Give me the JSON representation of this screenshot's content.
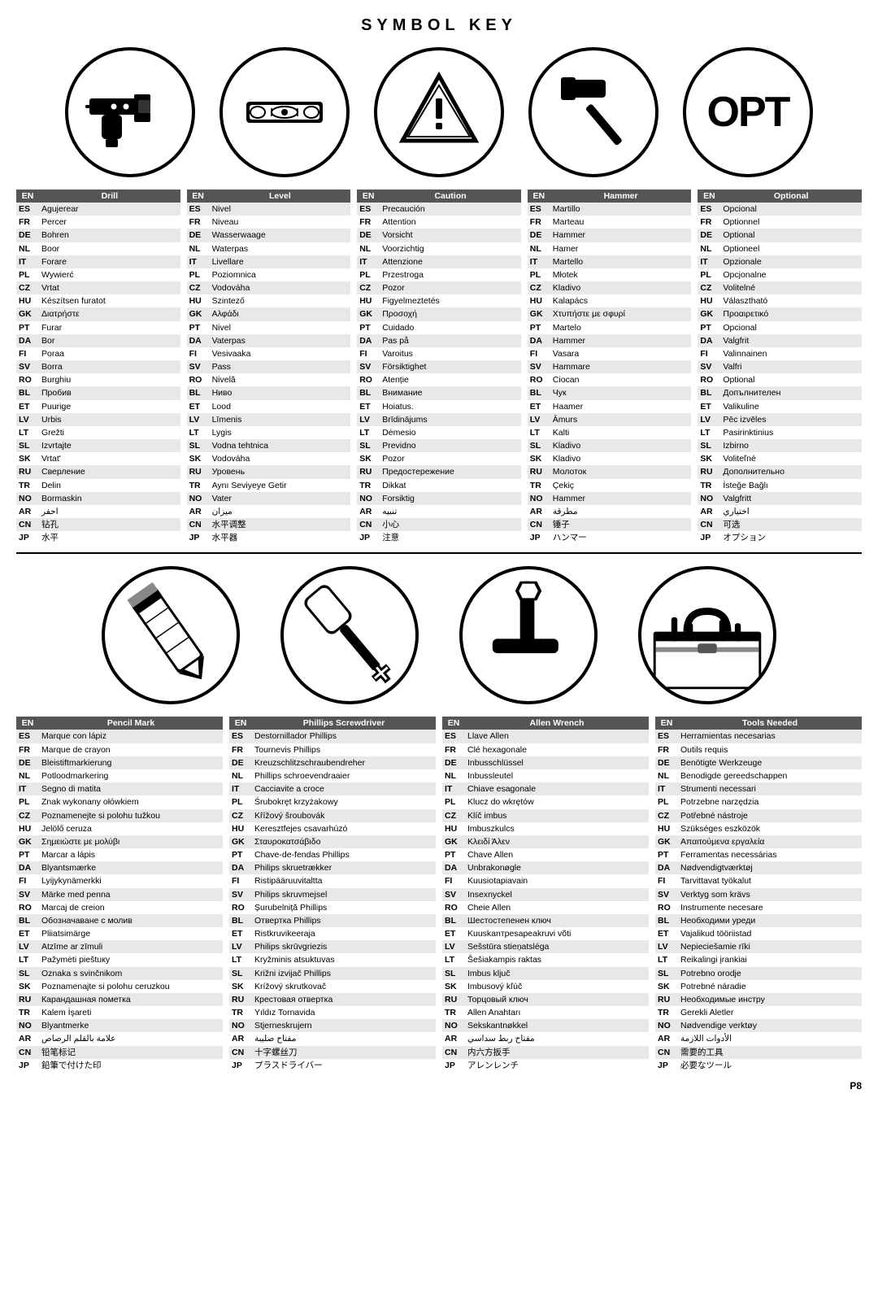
{
  "title": "SYMBOL KEY",
  "page_number": "P8",
  "icons_row1": [
    {
      "name": "drill",
      "type": "drill"
    },
    {
      "name": "level",
      "type": "level"
    },
    {
      "name": "caution",
      "type": "caution"
    },
    {
      "name": "hammer",
      "type": "hammer"
    },
    {
      "name": "optional",
      "type": "opt-text",
      "text": "OPT"
    }
  ],
  "icons_row2": [
    {
      "name": "pencil",
      "type": "pencil"
    },
    {
      "name": "phillips",
      "type": "phillips"
    },
    {
      "name": "allen",
      "type": "allen"
    },
    {
      "name": "toolbox",
      "type": "toolbox"
    }
  ],
  "tables": [
    {
      "id": "drill",
      "header1": "EN",
      "header2": "Drill",
      "rows": [
        [
          "ES",
          "Agujerear"
        ],
        [
          "FR",
          "Percer"
        ],
        [
          "DE",
          "Bohren"
        ],
        [
          "NL",
          "Boor"
        ],
        [
          "IT",
          "Forare"
        ],
        [
          "PL",
          "Wywierć"
        ],
        [
          "CZ",
          "Vrtat"
        ],
        [
          "HU",
          "Készítsen furatot"
        ],
        [
          "GK",
          "Διατρήστε"
        ],
        [
          "PT",
          "Furar"
        ],
        [
          "DA",
          "Bor"
        ],
        [
          "FI",
          "Poraa"
        ],
        [
          "SV",
          "Borra"
        ],
        [
          "RO",
          "Burghiu"
        ],
        [
          "BL",
          "Пробив"
        ],
        [
          "ET",
          "Puurige"
        ],
        [
          "LV",
          "Urbis"
        ],
        [
          "LT",
          "Grežti"
        ],
        [
          "SL",
          "Izvrtajte"
        ],
        [
          "SK",
          "Vrtat'"
        ],
        [
          "RU",
          "Сверление"
        ],
        [
          "TR",
          "Delin"
        ],
        [
          "NO",
          "Bormaskin"
        ],
        [
          "AR",
          "احفر"
        ],
        [
          "CN",
          "钻孔"
        ],
        [
          "JP",
          "水平"
        ]
      ]
    },
    {
      "id": "level",
      "header1": "EN",
      "header2": "Level",
      "rows": [
        [
          "ES",
          "Nivel"
        ],
        [
          "FR",
          "Niveau"
        ],
        [
          "DE",
          "Wasserwaage"
        ],
        [
          "NL",
          "Waterpas"
        ],
        [
          "IT",
          "Livellare"
        ],
        [
          "PL",
          "Poziomnica"
        ],
        [
          "CZ",
          "Vodováha"
        ],
        [
          "HU",
          "Szintező"
        ],
        [
          "GK",
          "Αλφάδι"
        ],
        [
          "PT",
          "Nivel"
        ],
        [
          "DA",
          "Vaterpas"
        ],
        [
          "FI",
          "Vesivaaka"
        ],
        [
          "SV",
          "Pass"
        ],
        [
          "RO",
          "Nivelă"
        ],
        [
          "BL",
          "Ниво"
        ],
        [
          "ET",
          "Lood"
        ],
        [
          "LV",
          "Līmenis"
        ],
        [
          "LT",
          "Lygis"
        ],
        [
          "SL",
          "Vodna tehtnica"
        ],
        [
          "SK",
          "Vodováha"
        ],
        [
          "RU",
          "Уровень"
        ],
        [
          "TR",
          "Aynı Seviyeye Getir"
        ],
        [
          "NO",
          "Vater"
        ],
        [
          "AR",
          "ميزان"
        ],
        [
          "CN",
          "水平调整"
        ],
        [
          "JP",
          "水平器"
        ]
      ]
    },
    {
      "id": "caution",
      "header1": "EN",
      "header2": "Caution",
      "rows": [
        [
          "ES",
          "Precaución"
        ],
        [
          "FR",
          "Attention"
        ],
        [
          "DE",
          "Vorsicht"
        ],
        [
          "NL",
          "Voorzichtig"
        ],
        [
          "IT",
          "Attenzione"
        ],
        [
          "PL",
          "Przestroga"
        ],
        [
          "CZ",
          "Pozor"
        ],
        [
          "HU",
          "Figyelmeztetés"
        ],
        [
          "GK",
          "Προσοχή"
        ],
        [
          "PT",
          "Cuidado"
        ],
        [
          "DA",
          "Pas på"
        ],
        [
          "FI",
          "Varoitus"
        ],
        [
          "SV",
          "Försiktighet"
        ],
        [
          "RO",
          "Atenție"
        ],
        [
          "BL",
          "Внимание"
        ],
        [
          "ET",
          "Hoiatus."
        ],
        [
          "LV",
          "Brīdinājums"
        ],
        [
          "LT",
          "Dėmesio"
        ],
        [
          "SL",
          "Previdno"
        ],
        [
          "SK",
          "Pozor"
        ],
        [
          "RU",
          "Предостережение"
        ],
        [
          "TR",
          "Dikkat"
        ],
        [
          "NO",
          "Forsiktig"
        ],
        [
          "AR",
          "تنبيه"
        ],
        [
          "CN",
          "小心"
        ],
        [
          "JP",
          "注意"
        ]
      ]
    },
    {
      "id": "hammer",
      "header1": "EN",
      "header2": "Hammer",
      "rows": [
        [
          "ES",
          "Martillo"
        ],
        [
          "FR",
          "Marteau"
        ],
        [
          "DE",
          "Hammer"
        ],
        [
          "NL",
          "Hamer"
        ],
        [
          "IT",
          "Martello"
        ],
        [
          "PL",
          "Młotek"
        ],
        [
          "CZ",
          "Kladivo"
        ],
        [
          "HU",
          "Kalapács"
        ],
        [
          "GK",
          "Χτυπήστε με σφυρί"
        ],
        [
          "PT",
          "Martelo"
        ],
        [
          "DA",
          "Hammer"
        ],
        [
          "FI",
          "Vasara"
        ],
        [
          "SV",
          "Hammare"
        ],
        [
          "RO",
          "Ciocan"
        ],
        [
          "BL",
          "Чук"
        ],
        [
          "ET",
          "Haamer"
        ],
        [
          "LV",
          "Āmurs"
        ],
        [
          "LT",
          "Kalti"
        ],
        [
          "SL",
          "Kladivo"
        ],
        [
          "SK",
          "Kladivo"
        ],
        [
          "RU",
          "Молоток"
        ],
        [
          "TR",
          "Çekiç"
        ],
        [
          "NO",
          "Hammer"
        ],
        [
          "AR",
          "مطرقة"
        ],
        [
          "CN",
          "锤子"
        ],
        [
          "JP",
          "ハンマー"
        ]
      ]
    },
    {
      "id": "optional",
      "header1": "EN",
      "header2": "Optional",
      "rows": [
        [
          "ES",
          "Opcional"
        ],
        [
          "FR",
          "Optionnel"
        ],
        [
          "DE",
          "Optional"
        ],
        [
          "NL",
          "Optioneel"
        ],
        [
          "IT",
          "Opzionale"
        ],
        [
          "PL",
          "Opcjonalne"
        ],
        [
          "CZ",
          "Volitelné"
        ],
        [
          "HU",
          "Választható"
        ],
        [
          "GK",
          "Προαιρετικό"
        ],
        [
          "PT",
          "Opcional"
        ],
        [
          "DA",
          "Valgfrit"
        ],
        [
          "FI",
          "Valinnainen"
        ],
        [
          "SV",
          "Valfri"
        ],
        [
          "RO",
          "Optional"
        ],
        [
          "BL",
          "Допълнителен"
        ],
        [
          "ET",
          "Valikuline"
        ],
        [
          "LV",
          "Pēc izvēles"
        ],
        [
          "LT",
          "Pasirinktinius"
        ],
        [
          "SL",
          "Izbirno"
        ],
        [
          "SK",
          "Voliteľné"
        ],
        [
          "RU",
          "Дополнительно"
        ],
        [
          "TR",
          "İsteğe Bağlı"
        ],
        [
          "NO",
          "Valgfritt"
        ],
        [
          "AR",
          "اختياري"
        ],
        [
          "CN",
          "可选"
        ],
        [
          "JP",
          "オプション"
        ]
      ]
    }
  ],
  "tables2": [
    {
      "id": "pencil",
      "header1": "EN",
      "header2": "Pencil Mark",
      "rows": [
        [
          "ES",
          "Marque con lápiz"
        ],
        [
          "FR",
          "Marque de crayon"
        ],
        [
          "DE",
          "Bleistiftmarkierung"
        ],
        [
          "NL",
          "Potloodmarkering"
        ],
        [
          "IT",
          "Segno di matita"
        ],
        [
          "PL",
          "Znak wykonany ołówkiem"
        ],
        [
          "CZ",
          "Poznamenejte si polohu tužkou"
        ],
        [
          "HU",
          "Jelölő ceruza"
        ],
        [
          "GK",
          "Σημειώστε με μολύβι"
        ],
        [
          "PT",
          "Marcar a lápis"
        ],
        [
          "DA",
          "Blyantsmærke"
        ],
        [
          "FI",
          "Lyijykynämerkki"
        ],
        [
          "SV",
          "Märke med penna"
        ],
        [
          "RO",
          "Marcaj de creion"
        ],
        [
          "BL",
          "Обозначаване с молив"
        ],
        [
          "ET",
          "Pliiatsimärge"
        ],
        [
          "LV",
          "Atzīme ar zīmuli"
        ],
        [
          "LT",
          "Pažymėti pieštuку"
        ],
        [
          "SL",
          "Oznaka s svinčnikom"
        ],
        [
          "SK",
          "Poznamenajte si polohu ceruzkou"
        ],
        [
          "RU",
          "Карандашная пометка"
        ],
        [
          "TR",
          "Kalem İşareti"
        ],
        [
          "NO",
          "Blyantmerke"
        ],
        [
          "AR",
          "علامة بالقلم الرصاص"
        ],
        [
          "CN",
          "铅笔标记"
        ],
        [
          "JP",
          "鉛筆で付けた印"
        ]
      ]
    },
    {
      "id": "phillips",
      "header1": "EN",
      "header2": "Phillips Screwdriver",
      "rows": [
        [
          "ES",
          "Destornillador Phillips"
        ],
        [
          "FR",
          "Tournevis Phillips"
        ],
        [
          "DE",
          "Kreuzschlitzschraubendreher"
        ],
        [
          "NL",
          "Phillips schroevendraaier"
        ],
        [
          "IT",
          "Cacciavite a croce"
        ],
        [
          "PL",
          "Śrubokręt krzyżakowy"
        ],
        [
          "CZ",
          "Křížový šroubovák"
        ],
        [
          "HU",
          "Keresztfejes csavarhúzó"
        ],
        [
          "GK",
          "Σταυροκατσάβιδο"
        ],
        [
          "PT",
          "Chave-de-fendas Phillips"
        ],
        [
          "DA",
          "Philips skruetrækker"
        ],
        [
          "FI",
          "Ristipääruuvitaltta"
        ],
        [
          "SV",
          "Philips skruvmejsel"
        ],
        [
          "RO",
          "Șurubelniță Phillips"
        ],
        [
          "BL",
          "Отвертка Phillips"
        ],
        [
          "ET",
          "Ristkruvikeeraja"
        ],
        [
          "LV",
          "Philips skrūvgriezis"
        ],
        [
          "LT",
          "Kryžminis atsuktuvas"
        ],
        [
          "SL",
          "Križni izvijač Phillips"
        ],
        [
          "SK",
          "Krížový skrutkovač"
        ],
        [
          "RU",
          "Крестовая отвертка"
        ],
        [
          "TR",
          "Yıldız Tornavida"
        ],
        [
          "NO",
          "Stjerneskrujern"
        ],
        [
          "AR",
          "مفتاح صليبة"
        ],
        [
          "CN",
          "十字螺丝刀"
        ],
        [
          "JP",
          "プラスドライバー"
        ]
      ]
    },
    {
      "id": "allen",
      "header1": "EN",
      "header2": "Allen Wrench",
      "rows": [
        [
          "ES",
          "Llave Allen"
        ],
        [
          "FR",
          "Clé hexagonale"
        ],
        [
          "DE",
          "Inbusschlüssel"
        ],
        [
          "NL",
          "Inbussleutel"
        ],
        [
          "IT",
          "Chiave esagonale"
        ],
        [
          "PL",
          "Klucz do wkrętów"
        ],
        [
          "CZ",
          "Klíč imbus"
        ],
        [
          "HU",
          "Imbuszkulcs"
        ],
        [
          "GK",
          "Κλειδί Άλεν"
        ],
        [
          "PT",
          "Chave Allen"
        ],
        [
          "DA",
          "Unbrakonøgle"
        ],
        [
          "FI",
          "Kuusiotapiavain"
        ],
        [
          "SV",
          "Insexnyckel"
        ],
        [
          "RO",
          "Cheie Allen"
        ],
        [
          "BL",
          "Шестостепенен ключ"
        ],
        [
          "ET",
          "Kuuskanтpesapeakruvi võti"
        ],
        [
          "LV",
          "Sešstūra stieņatsléga"
        ],
        [
          "LT",
          "Šešiakampis raktas"
        ],
        [
          "SL",
          "Imbus ključ"
        ],
        [
          "SK",
          "Imbusový kľúč"
        ],
        [
          "RU",
          "Торцовый ключ"
        ],
        [
          "TR",
          "Allen Anahtarı"
        ],
        [
          "NO",
          "Sekskantnøkkel"
        ],
        [
          "AR",
          "مفتاح ربط سداسي"
        ],
        [
          "CN",
          "内六方扳手"
        ],
        [
          "JP",
          "アレンレンチ"
        ]
      ]
    },
    {
      "id": "tools",
      "header1": "EN",
      "header2": "Tools Needed",
      "rows": [
        [
          "ES",
          "Herramientas necesarias"
        ],
        [
          "FR",
          "Outils requis"
        ],
        [
          "DE",
          "Benötigte Werkzeuge"
        ],
        [
          "NL",
          "Benodigde gereedschappen"
        ],
        [
          "IT",
          "Strumenti necessari"
        ],
        [
          "PL",
          "Potrzebne narzędzia"
        ],
        [
          "CZ",
          "Potřebné nástroje"
        ],
        [
          "HU",
          "Szükséges eszközök"
        ],
        [
          "GK",
          "Απαιτούμενα εργαλεία"
        ],
        [
          "PT",
          "Ferramentas necessárias"
        ],
        [
          "DA",
          "Nødvendigtværktøj"
        ],
        [
          "FI",
          "Tarvittavat työkalut"
        ],
        [
          "SV",
          "Verktyg som krävs"
        ],
        [
          "RO",
          "Instrumente necesare"
        ],
        [
          "BL",
          "Необходими уреди"
        ],
        [
          "ET",
          "Vajalikud tööriistad"
        ],
        [
          "LV",
          "Nepieciešamie rīki"
        ],
        [
          "LT",
          "Reikalingi įrankiai"
        ],
        [
          "SL",
          "Potrebno orodje"
        ],
        [
          "SK",
          "Potrebné náradie"
        ],
        [
          "RU",
          "Необходимые инстру"
        ],
        [
          "TR",
          "Gerekli Aletler"
        ],
        [
          "NO",
          "Nødvendige verktøy"
        ],
        [
          "AR",
          "الأدوات اللازمة"
        ],
        [
          "CN",
          "需要的工具"
        ],
        [
          "JP",
          "必要なツール"
        ]
      ]
    }
  ]
}
